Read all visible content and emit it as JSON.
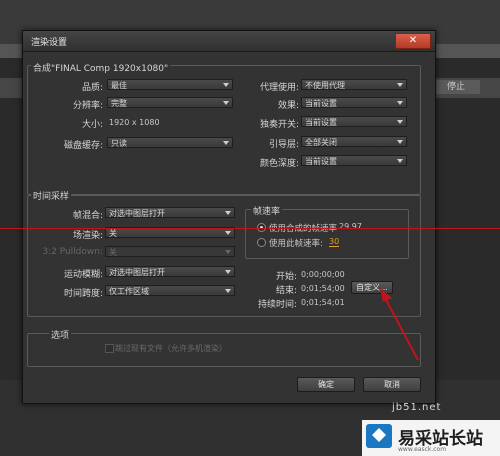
{
  "dialog": {
    "title": "渲染设置",
    "close_glyph": "✕",
    "comp_group_label": "合成\"FINAL Comp 1920x1080\"",
    "comp": {
      "quality_label": "品质:",
      "quality_value": "最佳",
      "resolution_label": "分辨率:",
      "resolution_value": "完整",
      "size_label": "大小:",
      "size_value": "1920 x 1080",
      "disk_cache_label": "磁盘缓存:",
      "disk_cache_value": "只读",
      "proxy_label": "代理使用:",
      "proxy_value": "不使用代理",
      "effects_label": "效果:",
      "effects_value": "当前设置",
      "solo_label": "独奏开关:",
      "solo_value": "当前设置",
      "guide_label": "引导层:",
      "guide_value": "全部关闭",
      "color_depth_label": "颜色深度:",
      "color_depth_value": "当前设置"
    },
    "time_group_label": "时间采样",
    "time": {
      "frame_blend_label": "帧混合:",
      "frame_blend_value": "对选中图层打开",
      "field_render_label": "场渲染:",
      "field_render_value": "关",
      "pulldown_label": "3:2 Pulldown:",
      "pulldown_value": "关",
      "motion_blur_label": "运动模糊:",
      "motion_blur_value": "对选中图层打开",
      "time_span_label": "时间跨度:",
      "time_span_value": "仅工作区域"
    },
    "frame_rate": {
      "group_label": "帧速率",
      "use_comp_label": "使用合成的帧速率",
      "use_comp_value": "29.97",
      "use_custom_label": "使用此帧速率:",
      "use_custom_value": "30"
    },
    "timing": {
      "start_label": "开始:",
      "start_value": "0;00;00;00",
      "end_label": "结束:",
      "end_value": "0;01;54;00",
      "duration_label": "持续时间:",
      "duration_value": "0;01;54;01",
      "custom_button": "自定义..."
    },
    "options": {
      "group_label": "选项",
      "skip_existing_label": "跳过现有文件（允许多机渲染）"
    },
    "ok_button": "确定",
    "cancel_button": "取消"
  },
  "background": {
    "stop_button": "停止"
  },
  "watermark": {
    "brand": "易采站长站",
    "url": "www.easck.com",
    "site_text": "jb51.net"
  },
  "colors": {
    "accent_orange": "#e0a020",
    "arrow_red": "#c0141c",
    "close_red": "#c8472f"
  }
}
